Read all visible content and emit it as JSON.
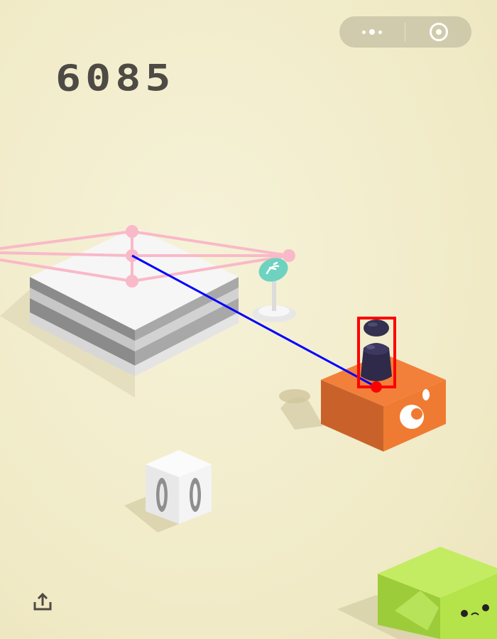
{
  "game": {
    "score": "6085"
  },
  "capsule": {
    "more_icon": "more-dots-icon",
    "close_icon": "circle-target-icon"
  },
  "controls": {
    "share_icon": "share-upload-icon"
  },
  "colors": {
    "background": "#f3eed0",
    "score_text": "#4e4a44",
    "orange_block": "#ef7b32",
    "green_block": "#b5e34a",
    "white_block": "#f2f2f2",
    "pink_lines": "#f9b9c8",
    "aim_line": "#0000ff",
    "target_box": "#ff0000",
    "player": "#2f2a4a",
    "bonus_disc": "#6dd3c0"
  }
}
